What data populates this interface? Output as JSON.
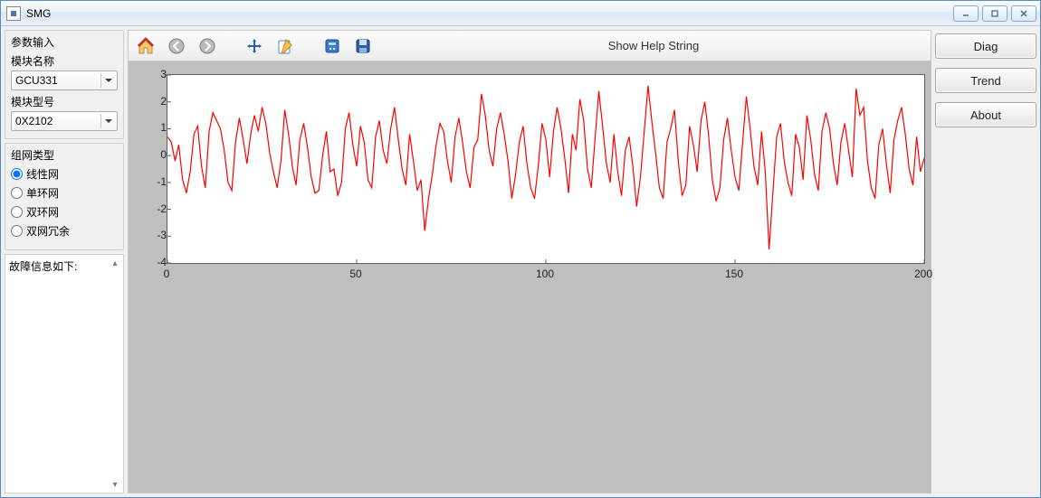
{
  "window": {
    "title": "SMG"
  },
  "sidebar": {
    "group_input_legend": "参数输入",
    "module_name_label": "模块名称",
    "module_name_value": "GCU331",
    "module_model_label": "模块型号",
    "module_model_value": "0X2102",
    "net_type_legend": "组网类型",
    "radios": [
      {
        "label": "线性网",
        "checked": true
      },
      {
        "label": "单环网",
        "checked": false
      },
      {
        "label": "双环网",
        "checked": false
      },
      {
        "label": "双网冗余",
        "checked": false
      }
    ],
    "fault_text": "故障信息如下:"
  },
  "toolbar": {
    "help_string": "Show Help String",
    "icons": [
      "home-icon",
      "back-icon",
      "forward-icon",
      "pan-icon",
      "edit-icon",
      "config-icon",
      "save-icon"
    ]
  },
  "right_buttons": {
    "diag": "Diag",
    "trend": "Trend",
    "about": "About"
  },
  "chart_data": {
    "type": "line",
    "xlabel": "",
    "ylabel": "",
    "xlim": [
      0,
      200
    ],
    "ylim": [
      -4,
      3
    ],
    "xticks": [
      0,
      50,
      100,
      150,
      200
    ],
    "yticks": [
      -4,
      -3,
      -2,
      -1,
      0,
      1,
      2,
      3
    ],
    "color": "#ff0000",
    "x_step": 1,
    "values": [
      0.7,
      0.5,
      -0.2,
      0.4,
      -0.9,
      -1.4,
      -0.6,
      0.8,
      1.1,
      -0.4,
      -1.2,
      0.9,
      1.6,
      1.3,
      1.0,
      0.2,
      -1.0,
      -1.3,
      0.5,
      1.4,
      0.6,
      -0.3,
      0.8,
      1.5,
      0.9,
      1.8,
      1.2,
      0.1,
      -0.6,
      -1.2,
      -0.2,
      1.7,
      0.8,
      -0.4,
      -1.1,
      0.6,
      1.2,
      0.3,
      -0.8,
      -1.4,
      -1.3,
      0.0,
      0.9,
      -0.6,
      -0.5,
      -1.5,
      -1.0,
      1.0,
      1.6,
      0.4,
      -0.4,
      1.1,
      0.5,
      -0.9,
      -1.2,
      0.7,
      1.3,
      0.2,
      -0.3,
      1.0,
      1.8,
      0.6,
      -0.5,
      -1.1,
      0.8,
      -0.2,
      -1.3,
      -0.9,
      -2.8,
      -1.6,
      -0.7,
      0.4,
      1.2,
      0.9,
      -0.2,
      -1.0,
      0.7,
      1.4,
      0.5,
      -0.6,
      -1.2,
      0.3,
      0.6,
      2.3,
      1.5,
      0.2,
      -0.4,
      1.0,
      1.6,
      0.8,
      -0.2,
      -1.6,
      -0.7,
      0.5,
      1.1,
      -0.3,
      -1.2,
      -1.6,
      -0.4,
      1.2,
      0.6,
      -0.8,
      0.9,
      1.8,
      1.0,
      -0.1,
      -1.4,
      0.8,
      0.2,
      2.1,
      1.3,
      -0.5,
      -1.2,
      0.6,
      2.4,
      1.1,
      -0.3,
      -1.0,
      0.8,
      -0.6,
      -1.5,
      0.2,
      0.7,
      -0.4,
      -1.9,
      -0.8,
      0.9,
      2.6,
      1.3,
      0.1,
      -1.2,
      -1.6,
      0.5,
      1.0,
      1.7,
      -0.2,
      -1.5,
      -1.1,
      1.1,
      0.4,
      -0.6,
      1.3,
      2.0,
      0.8,
      -0.9,
      -1.7,
      -1.2,
      0.6,
      1.4,
      0.2,
      -0.8,
      -1.3,
      0.5,
      2.2,
      1.0,
      -0.4,
      -1.1,
      0.9,
      -0.6,
      -3.5,
      -1.4,
      0.7,
      1.2,
      -0.2,
      -1.0,
      -1.5,
      0.8,
      0.3,
      -0.9,
      1.5,
      0.6,
      -0.7,
      -1.3,
      0.9,
      1.6,
      1.0,
      -0.3,
      -1.1,
      0.5,
      1.2,
      0.2,
      -0.8,
      2.5,
      1.5,
      1.8,
      -0.2,
      -1.2,
      -1.6,
      0.4,
      1.0,
      -0.3,
      -1.4,
      0.6,
      1.3,
      1.8,
      0.8,
      -0.5,
      -1.1,
      0.7,
      -0.6,
      -0.1
    ]
  }
}
